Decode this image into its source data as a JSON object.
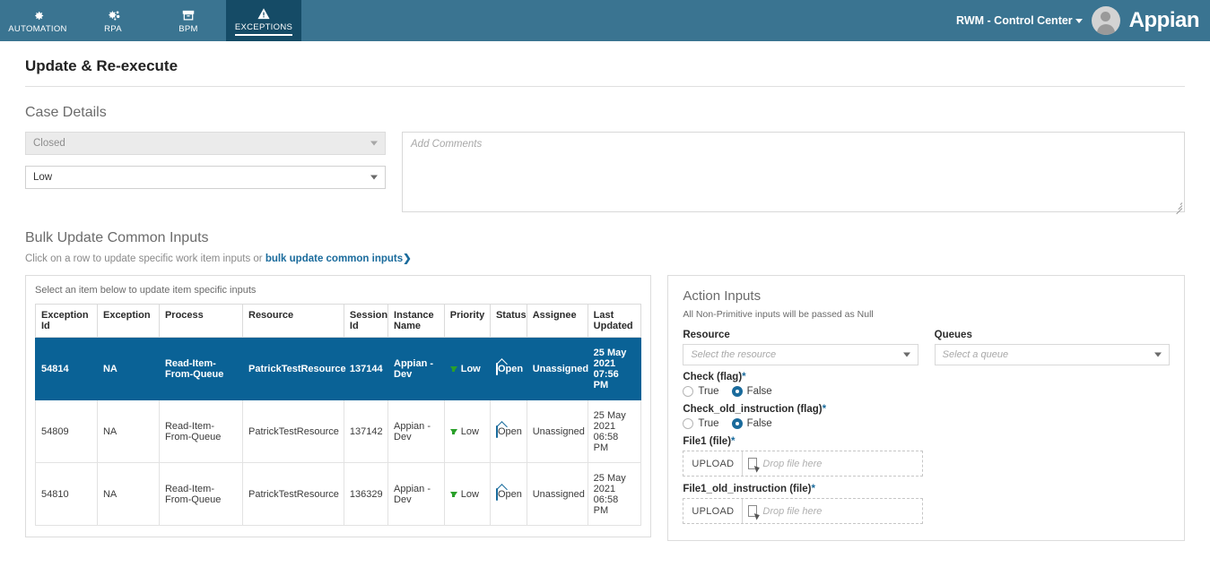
{
  "topnav": {
    "tabs": [
      {
        "label": "AUTOMATION",
        "icon": "gear-icon",
        "active": false
      },
      {
        "label": "RPA",
        "icon": "gears-icon",
        "active": false
      },
      {
        "label": "BPM",
        "icon": "archive-box-icon",
        "active": false
      },
      {
        "label": "EXCEPTIONS",
        "icon": "warning-triangle-icon",
        "active": true
      }
    ],
    "user_menu": "RWM - Control Center",
    "brand": "Appian",
    "bg_color": "#3a7491",
    "active_tab_color": "#154b66"
  },
  "page": {
    "title": "Update & Re-execute"
  },
  "case_details": {
    "heading": "Case Details",
    "status_select": {
      "value": "Closed",
      "disabled": true
    },
    "priority_select": {
      "value": "Low",
      "disabled": false
    },
    "comments": {
      "placeholder": "Add Comments",
      "value": ""
    }
  },
  "bulk_update": {
    "heading": "Bulk Update Common Inputs",
    "hint_prefix": "Click on a row to update specific work item inputs or ",
    "hint_link": "bulk update common inputs",
    "hint_chevron": "❯",
    "panel_hint": "Select an item below to update item specific inputs",
    "columns": [
      "Exception Id",
      "Exception",
      "Process",
      "Resource",
      "Session Id",
      "Instance Name",
      "Priority",
      "Status",
      "Assignee",
      "Last Updated"
    ],
    "rows": [
      {
        "exception_id": "54814",
        "exception": "NA",
        "process": "Read-Item-From-Queue",
        "resource": "PatrickTestResource",
        "session_id": "137144",
        "instance_name": "Appian - Dev",
        "priority": "Low",
        "status": "Open",
        "assignee": "Unassigned",
        "last_updated": "25 May 2021 07:56 PM",
        "selected": true
      },
      {
        "exception_id": "54809",
        "exception": "NA",
        "process": "Read-Item-From-Queue",
        "resource": "PatrickTestResource",
        "session_id": "137142",
        "instance_name": "Appian - Dev",
        "priority": "Low",
        "status": "Open",
        "assignee": "Unassigned",
        "last_updated": "25 May 2021 06:58 PM",
        "selected": false
      },
      {
        "exception_id": "54810",
        "exception": "NA",
        "process": "Read-Item-From-Queue",
        "resource": "PatrickTestResource",
        "session_id": "136329",
        "instance_name": "Appian - Dev",
        "priority": "Low",
        "status": "Open",
        "assignee": "Unassigned",
        "last_updated": "25 May 2021 06:58 PM",
        "selected": false
      }
    ],
    "selected_row_color": "#0a6296",
    "priority_icon_color": "#2aa02a"
  },
  "action_inputs": {
    "heading": "Action Inputs",
    "note": "All Non-Primitive inputs will be passed as Null",
    "resource": {
      "label": "Resource",
      "placeholder": "Select the resource",
      "value": ""
    },
    "queues": {
      "label": "Queues",
      "placeholder": "Select a queue",
      "value": ""
    },
    "check_flag": {
      "label": "Check (flag)",
      "required_mark": "*",
      "options": [
        "True",
        "False"
      ],
      "selected": "False"
    },
    "check_old_instruction": {
      "label": "Check_old_instruction (flag)",
      "required_mark": "*",
      "options": [
        "True",
        "False"
      ],
      "selected": "False"
    },
    "file1": {
      "label": "File1 (file)",
      "required_mark": "*",
      "upload_button": "UPLOAD",
      "drop_placeholder": "Drop file here"
    },
    "file1_old_instruction": {
      "label": "File1_old_instruction (file)",
      "required_mark": "*",
      "upload_button": "UPLOAD",
      "drop_placeholder": "Drop file here"
    }
  }
}
